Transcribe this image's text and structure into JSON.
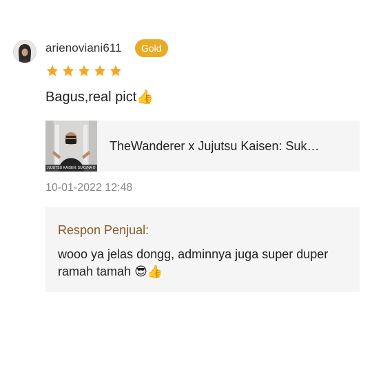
{
  "review": {
    "username": "arienoviani611",
    "badge": "Gold",
    "rating": 5,
    "text": "Bagus,real pict",
    "text_emoji": "👍",
    "timestamp": "10-01-2022 12:48"
  },
  "product": {
    "title": "TheWanderer x Jujutsu Kaisen: Suk…",
    "thumbnail_caption": "JUJUTSU KAISEN: SUKUNA ORI..."
  },
  "seller_reply": {
    "label": "Respon Penjual:",
    "text": "wooo ya jelas dongg, adminnya juga super duper ramah tamah ",
    "emojis": "😎👍"
  },
  "colors": {
    "badge": "#e8ab25",
    "star": "#f5a623",
    "reply_label": "#8a5a2b",
    "panel_bg": "#f5f5f5"
  },
  "icons": {
    "star": "star-icon"
  }
}
